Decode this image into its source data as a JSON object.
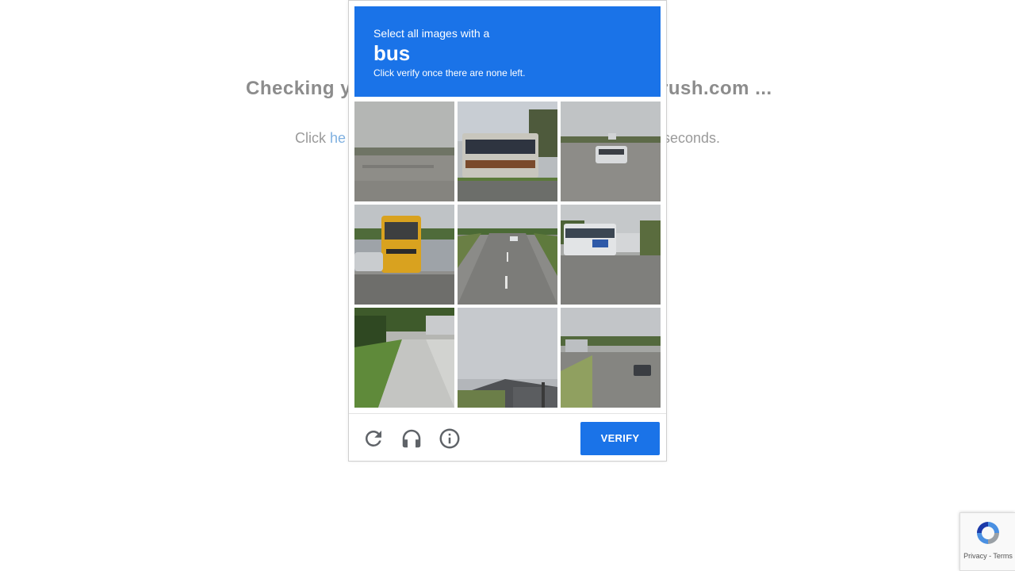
{
  "background": {
    "heading_left": "Checking y",
    "heading_right": "rush.com ...",
    "sub_left_prefix": "Click ",
    "sub_left_link": "he",
    "sub_right": "seconds."
  },
  "captcha": {
    "instruction": "Select all images with a",
    "target": "bus",
    "note": "Click verify once there are none left.",
    "tiles": [
      {
        "label": "tile-1"
      },
      {
        "label": "tile-2"
      },
      {
        "label": "tile-3"
      },
      {
        "label": "tile-4"
      },
      {
        "label": "tile-5"
      },
      {
        "label": "tile-6"
      },
      {
        "label": "tile-7"
      },
      {
        "label": "tile-8"
      },
      {
        "label": "tile-9"
      }
    ],
    "verify_label": "VERIFY",
    "icons": {
      "reload": "reload-icon",
      "audio": "headphones-icon",
      "info": "info-icon"
    }
  },
  "badge": {
    "text": "Privacy - Terms"
  },
  "colors": {
    "accent": "#1a73e8",
    "muted_text": "#8c8c8c",
    "link": "#7fb0e0"
  }
}
